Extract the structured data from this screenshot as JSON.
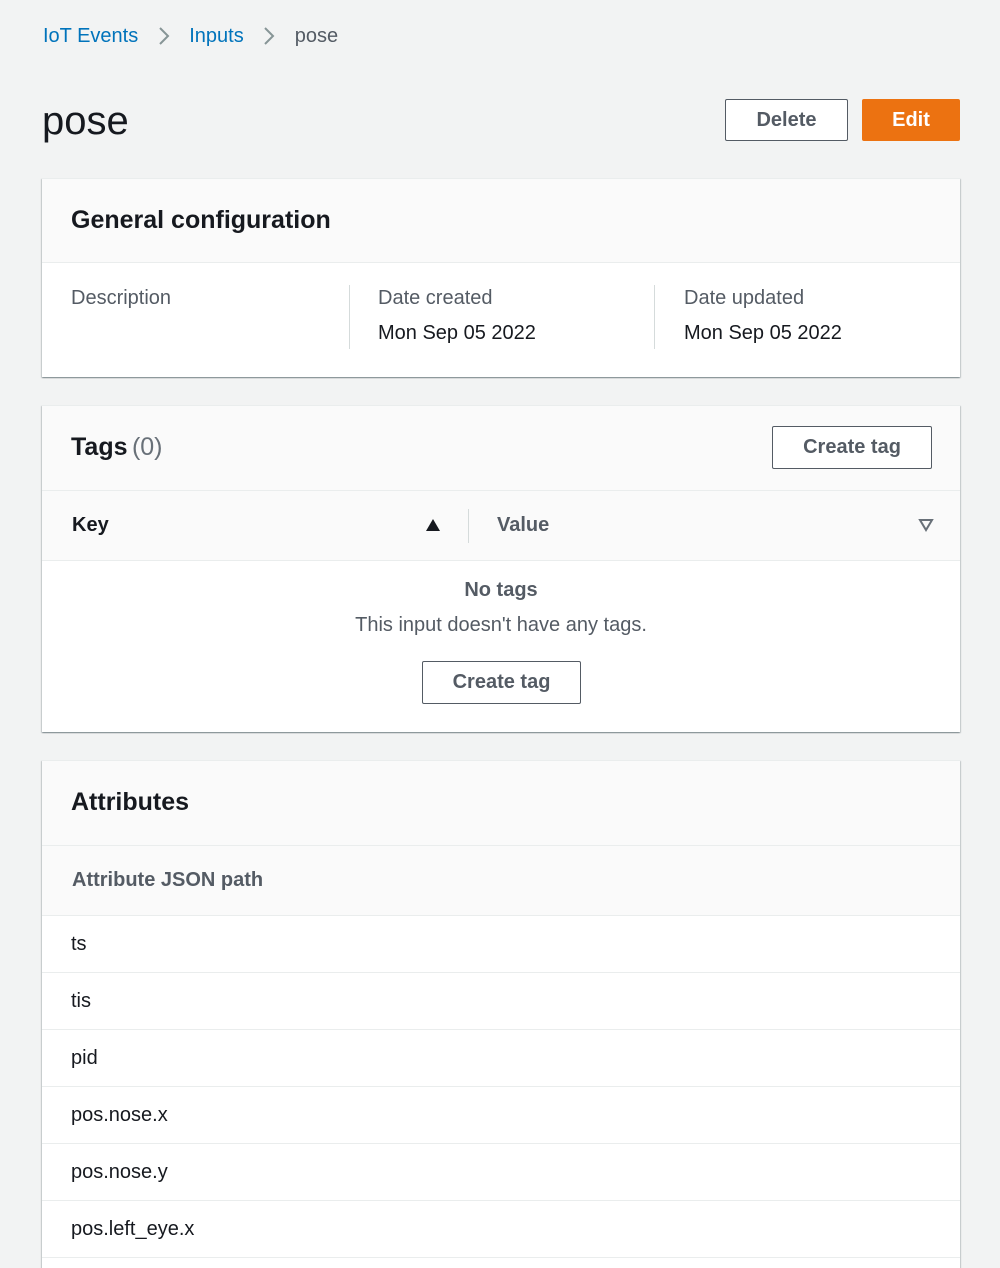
{
  "breadcrumb": {
    "items": [
      {
        "label": "IoT Events"
      },
      {
        "label": "Inputs"
      },
      {
        "label": "pose"
      }
    ]
  },
  "header": {
    "title": "pose",
    "delete_label": "Delete",
    "edit_label": "Edit"
  },
  "general_configuration": {
    "title": "General configuration",
    "fields": [
      {
        "label": "Description",
        "value": ""
      },
      {
        "label": "Date created",
        "value": "Mon Sep 05 2022"
      },
      {
        "label": "Date updated",
        "value": "Mon Sep 05 2022"
      }
    ]
  },
  "tags": {
    "title": "Tags",
    "count": "(0)",
    "create_label": "Create tag",
    "columns": {
      "key": "Key",
      "value": "Value"
    },
    "empty_title": "No tags",
    "empty_description": "This input doesn't have any tags.",
    "empty_create_label": "Create tag"
  },
  "attributes": {
    "title": "Attributes",
    "column": "Attribute JSON path",
    "rows": [
      "ts",
      "tis",
      "pid",
      "pos.nose.x",
      "pos.nose.y",
      "pos.left_eye.x"
    ]
  },
  "colors": {
    "link": "#0073bb",
    "primary": "#ec7211",
    "background": "#f2f3f3"
  },
  "icons": {
    "breadcrumb_separator": "chevron-right-icon",
    "key_sort": "sort-ascending-icon",
    "value_sort": "sort-descending-icon"
  }
}
